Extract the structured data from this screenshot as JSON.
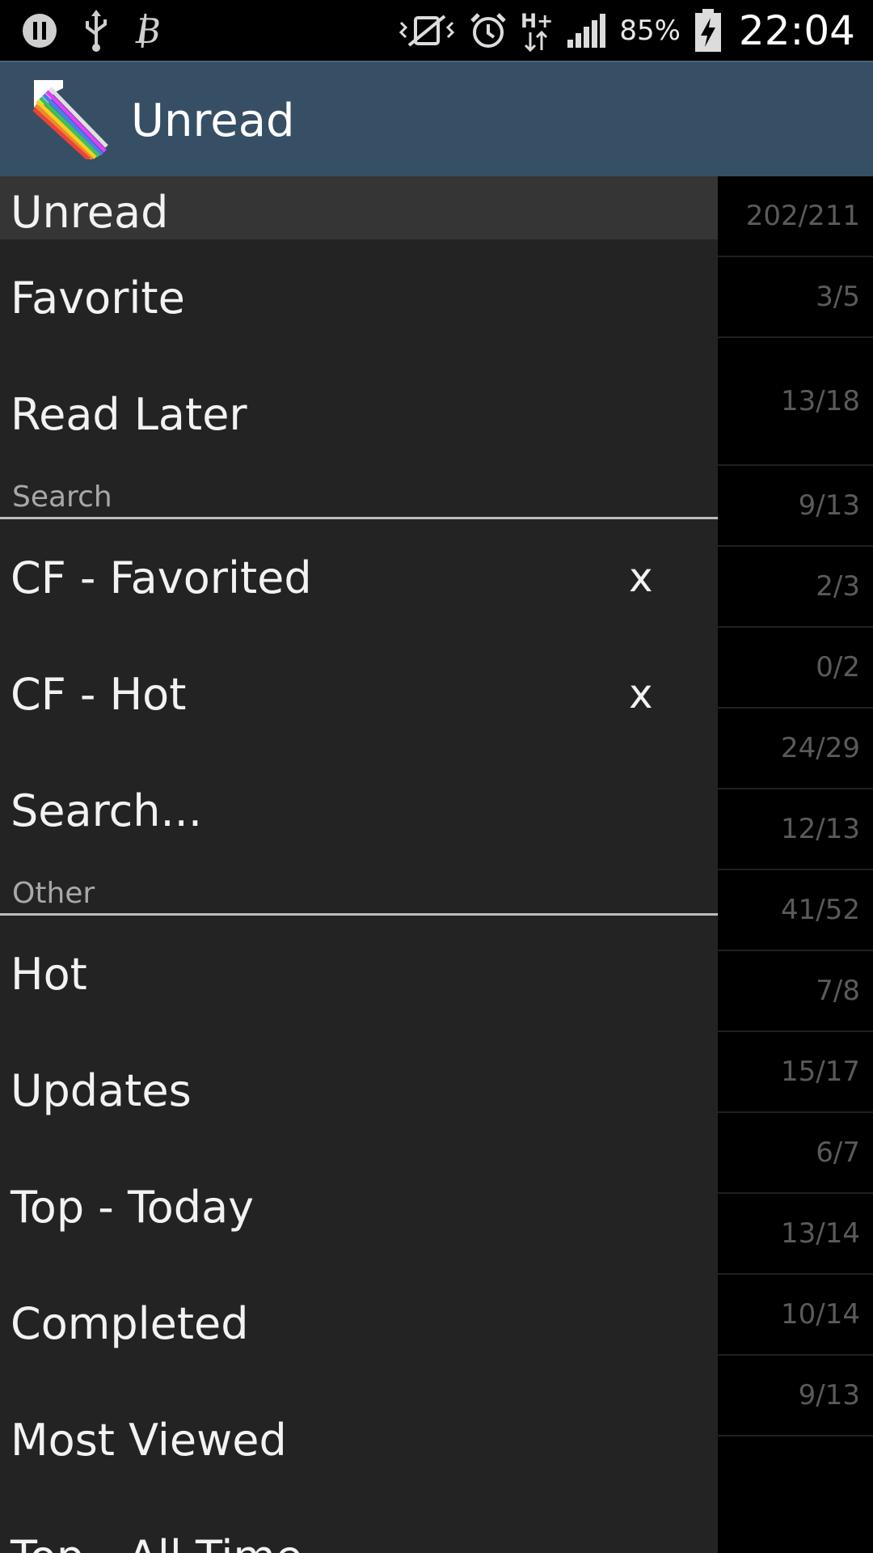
{
  "status_bar": {
    "battery_percent": "85%",
    "time": "22:04",
    "icons_left": [
      "pause-icon",
      "usb-icon",
      "bitcoin-icon"
    ],
    "icons_right": [
      "vibrate-icon",
      "alarm-icon",
      "hplus-icon",
      "signal-icon",
      "battery-charging-icon"
    ]
  },
  "action_bar": {
    "title": "Unread",
    "logo": "app-logo-rainbow-pencil"
  },
  "drawer": {
    "top_items": [
      {
        "label": "Unread"
      },
      {
        "label": "Favorite"
      },
      {
        "label": "Read Later"
      }
    ],
    "search_section": {
      "header": "Search",
      "items": [
        {
          "label": "CF - Favorited",
          "remove": "x"
        },
        {
          "label": "CF - Hot",
          "remove": "x"
        },
        {
          "label": "Search..."
        }
      ]
    },
    "other_section": {
      "header": "Other",
      "items": [
        {
          "label": "Hot"
        },
        {
          "label": "Updates"
        },
        {
          "label": "Top - Today"
        },
        {
          "label": "Completed"
        },
        {
          "label": "Most Viewed"
        },
        {
          "label": "Top - All Time"
        }
      ]
    }
  },
  "background_counts": [
    "202/211",
    "3/5",
    "13/18",
    "9/13",
    "2/3",
    "0/2",
    "24/29",
    "12/13",
    "41/52",
    "7/8",
    "15/17",
    "6/7",
    "13/14",
    "10/14",
    "9/13"
  ]
}
